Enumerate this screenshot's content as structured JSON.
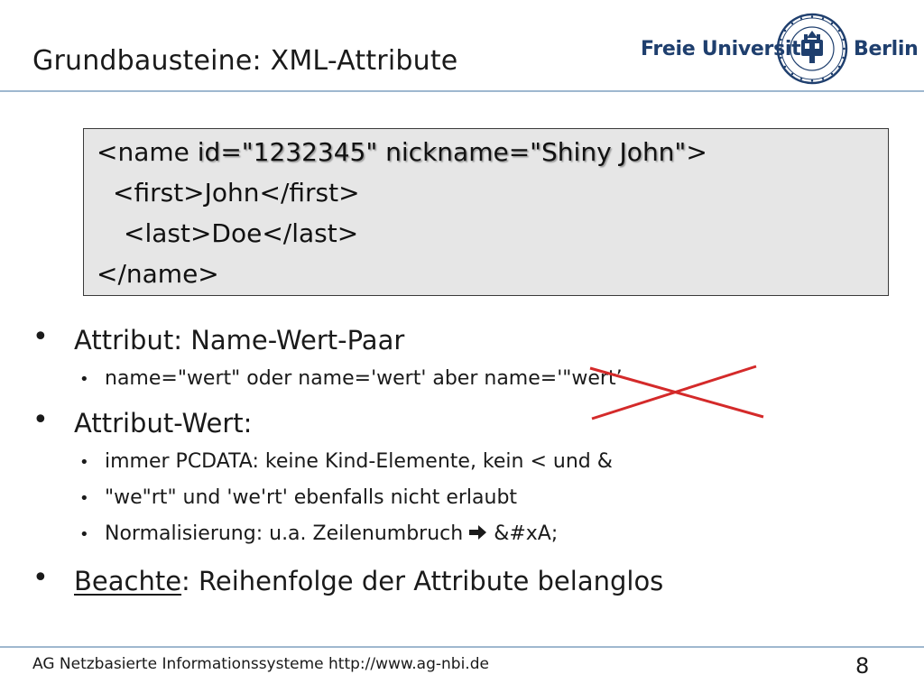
{
  "slide": {
    "title": "Grundbausteine: XML-Attribute",
    "page_number": "8"
  },
  "logo": {
    "left_text": "Freie Universität",
    "right_text": "Berlin",
    "seal_text": "VERITAS IUSTITIA LIBERTAS · FREIE UNIVERSITÄT BERLIN"
  },
  "code": {
    "line1_open": "<name ",
    "line1_attrs": "id=\"1232345\" nickname=\"Shiny John\"",
    "line1_close": ">",
    "line2": "<first>John</first>",
    "line3": "<last>Doe</last>",
    "line4": "</name>"
  },
  "bullets": {
    "b1": "Attribut: Name-Wert-Paar",
    "b1_sub1": "name=\"wert\" oder name='wert' aber name='\"wert’",
    "b2": "Attribut-Wert:",
    "b2_sub1": "immer PCDATA: keine Kind-Elemente, kein < und &",
    "b2_sub2": "\"we\"rt\" und 'we'rt' ebenfalls nicht erlaubt",
    "b2_sub3_pre": "Normalisierung: u.a. Zeilenumbruch",
    "b2_sub3_post": "&#xA;",
    "b3_underlined": "Beachte",
    "b3_rest": ": Reihenfolge der Attribute belanglos"
  },
  "footer": {
    "text": "AG Netzbasierte Informationssysteme http://www.ag-nbi.de"
  },
  "colors": {
    "rule": "#9fb8cf",
    "brand_blue": "#1f3f6e",
    "strike_red": "#d42a2a",
    "code_bg": "#e6e6e6"
  }
}
